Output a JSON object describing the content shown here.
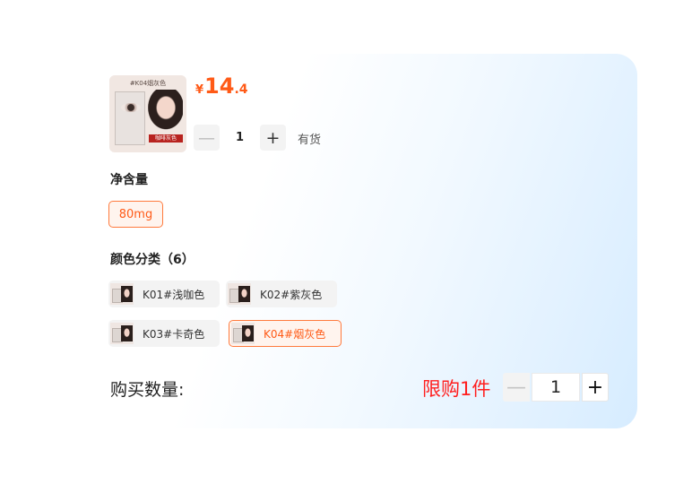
{
  "product": {
    "thumb_tag": "#K04烟灰色",
    "thumb_badge": "咖啡灰色",
    "price_currency": "¥",
    "price_int": "14",
    "price_dec": ".4",
    "quantity": "1",
    "minus_symbol": "—",
    "plus_symbol": "+",
    "stock": "有货"
  },
  "net_content": {
    "title": "净含量",
    "options": [
      {
        "label": "80mg",
        "selected": true
      }
    ]
  },
  "color": {
    "title": "颜色分类（6）",
    "options": [
      {
        "label": "K01#浅咖色",
        "selected": false
      },
      {
        "label": "K02#紫灰色",
        "selected": false
      },
      {
        "label": "K03#卡奇色",
        "selected": false
      },
      {
        "label": "K04#烟灰色",
        "selected": true
      }
    ]
  },
  "purchase": {
    "label": "购买数量:",
    "limit": "限购1件",
    "quantity": "1",
    "minus_symbol": "—",
    "plus_symbol": "+"
  },
  "colors": {
    "accent": "#ff5a17",
    "limit_red": "#ff1e1e",
    "selected_border": "#ff7a3d"
  }
}
